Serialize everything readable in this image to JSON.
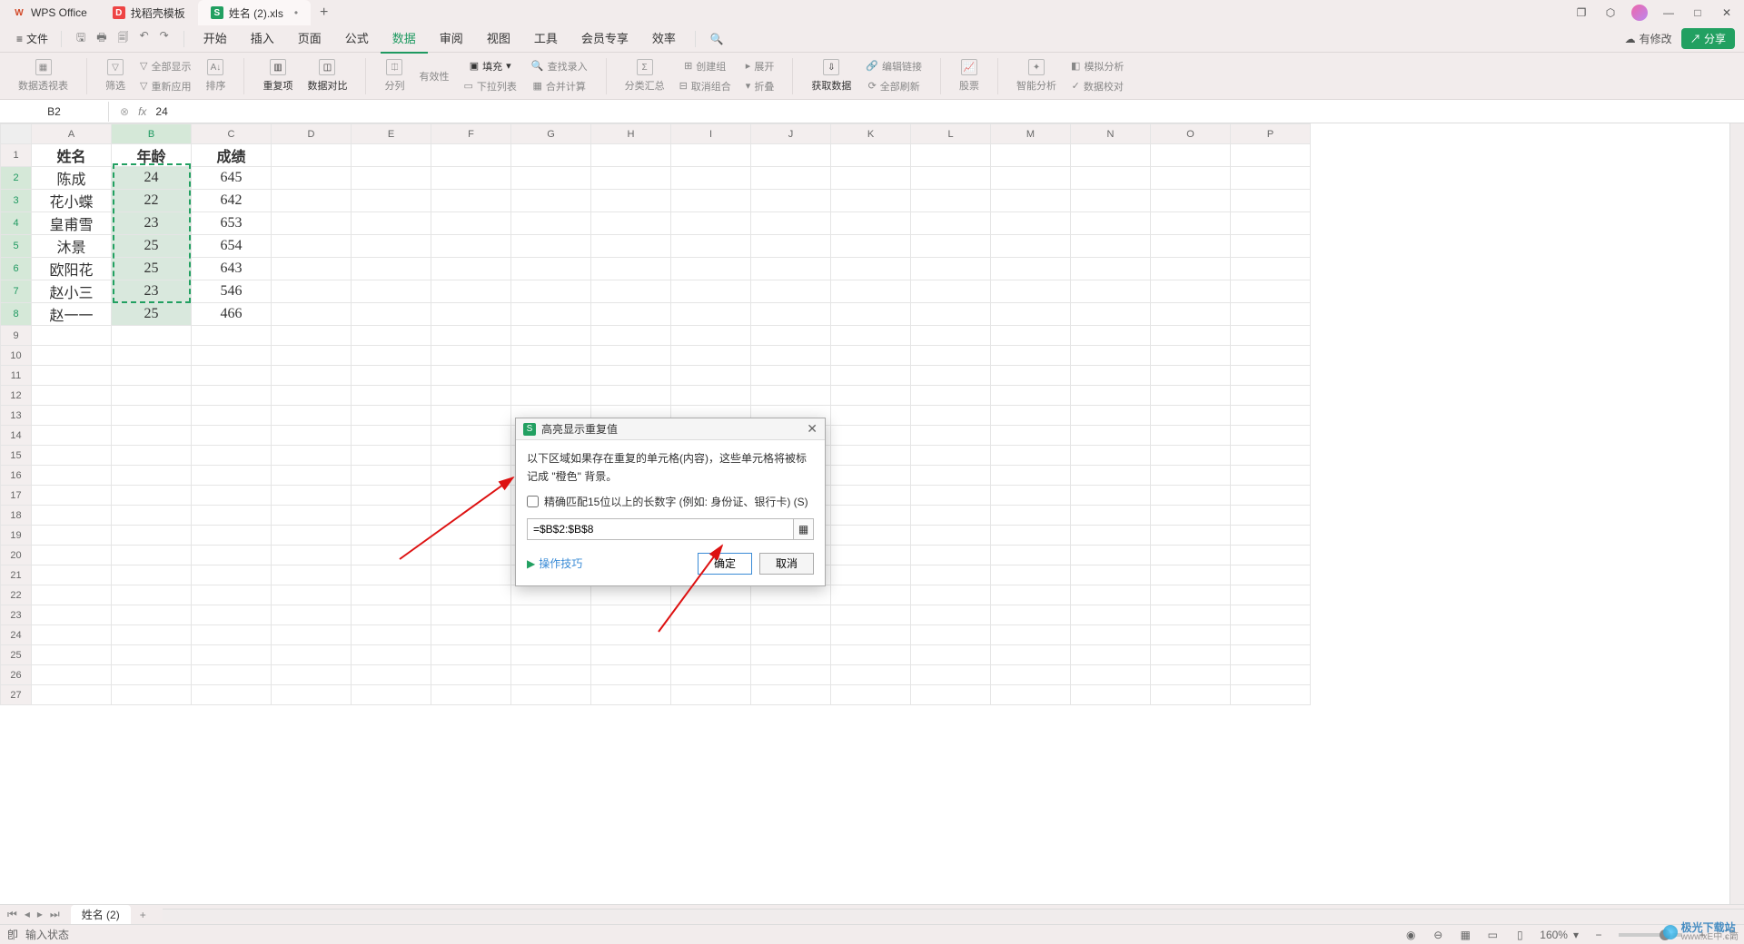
{
  "titlebar": {
    "app_tab": "WPS Office",
    "template_tab": "找稻壳模板",
    "file_tab": "姓名 (2).xls",
    "new_tab": "+"
  },
  "menubar": {
    "file": "文件",
    "items": [
      "开始",
      "插入",
      "页面",
      "公式",
      "数据",
      "审阅",
      "视图",
      "工具",
      "会员专享",
      "效率"
    ],
    "edit_badge": "有修改",
    "share": "分享"
  },
  "ribbon": {
    "pivot": "数据透视表",
    "filter": "筛选",
    "filter2": "全部显示",
    "reapply": "重新应用",
    "sort": "排序",
    "dup": "重复项",
    "compare": "数据对比",
    "split": "分列",
    "validate": "有效性",
    "fill": "填充",
    "dropdown": "下拉列表",
    "lookup": "查找录入",
    "consolidate": "合并计算",
    "subtotal": "分类汇总",
    "group": "创建组",
    "ungroup": "取消组合",
    "expand": "展开",
    "collapse": "折叠",
    "getdata": "获取数据",
    "editlink": "编辑链接",
    "refreshall": "全部刷新",
    "stock": "股票",
    "smart": "智能分析",
    "sim": "模拟分析",
    "check": "数据校对"
  },
  "namebox": {
    "cell": "B2",
    "formula": "24"
  },
  "columns": [
    "A",
    "B",
    "C",
    "D",
    "E",
    "F",
    "G",
    "H",
    "I",
    "J",
    "K",
    "L",
    "M",
    "N",
    "O",
    "P"
  ],
  "rows_shown": 27,
  "table": {
    "headers": [
      "姓名",
      "年龄",
      "成绩"
    ],
    "rows": [
      [
        "陈成",
        "24",
        "645"
      ],
      [
        "花小蝶",
        "22",
        "642"
      ],
      [
        "皇甫雪",
        "23",
        "653"
      ],
      [
        "沐景",
        "25",
        "654"
      ],
      [
        "欧阳花",
        "25",
        "643"
      ],
      [
        "赵小三",
        "23",
        "546"
      ],
      [
        "赵一一",
        "25",
        "466"
      ]
    ]
  },
  "selection": {
    "range": "B2:B8"
  },
  "dialog": {
    "title": "高亮显示重复值",
    "desc": "以下区域如果存在重复的单元格(内容)，这些单元格将被标记成 \"橙色\" 背景。",
    "checkbox": "精确匹配15位以上的长数字 (例如: 身份证、银行卡) (S)",
    "input": "=$B$2:$B$8",
    "tip": "操作技巧",
    "ok": "确定",
    "cancel": "取消"
  },
  "sheets": {
    "active": "姓名 (2)",
    "add": "+"
  },
  "statusbar": {
    "left_icon": "卽",
    "state": "输入状态",
    "zoom": "160%"
  },
  "watermark": {
    "text1": "极光下载站",
    "text2": "www.xE中.c筒"
  },
  "chart_data": {
    "type": "table",
    "title": "姓名/年龄/成绩",
    "columns": [
      "姓名",
      "年龄",
      "成绩"
    ],
    "rows": [
      {
        "姓名": "陈成",
        "年龄": 24,
        "成绩": 645
      },
      {
        "姓名": "花小蝶",
        "年龄": 22,
        "成绩": 642
      },
      {
        "姓名": "皇甫雪",
        "年龄": 23,
        "成绩": 653
      },
      {
        "姓名": "沐景",
        "年龄": 25,
        "成绩": 654
      },
      {
        "姓名": "欧阳花",
        "年龄": 25,
        "成绩": 643
      },
      {
        "姓名": "赵小三",
        "年龄": 23,
        "成绩": 546
      },
      {
        "姓名": "赵一一",
        "年龄": 25,
        "成绩": 466
      }
    ]
  }
}
